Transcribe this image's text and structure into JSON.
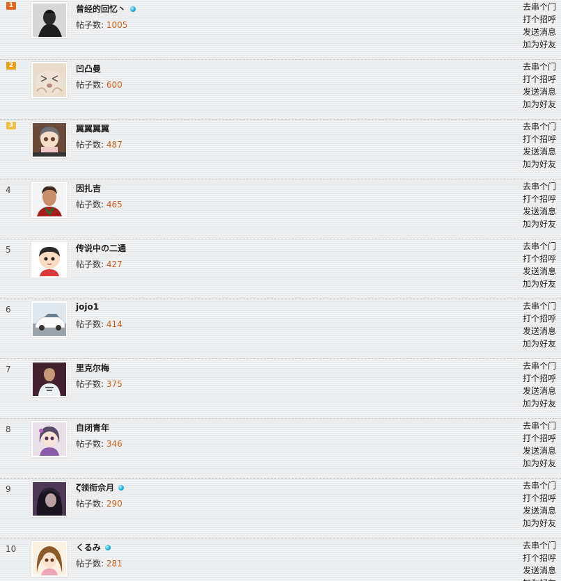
{
  "posts_label": "帖子数:",
  "actions": [
    "去串个门",
    "打个招呼",
    "发送消息",
    "加为好友"
  ],
  "colors": {
    "rank1": "#e06a20",
    "rank2": "#e8a318",
    "rank3": "#f0bf47",
    "post_count": "#c8601e"
  },
  "users": [
    {
      "rank": "1",
      "name": "曾经的回忆丶",
      "posts": "1005",
      "vip": true,
      "badge": "rank1",
      "avatar": "dark-portrait-avatar"
    },
    {
      "rank": "2",
      "name": "凹凸曼",
      "posts": "600",
      "vip": false,
      "badge": "rank2",
      "avatar": "cartoon-face-avatar"
    },
    {
      "rank": "3",
      "name": "翼翼翼翼",
      "posts": "487",
      "vip": false,
      "badge": "rank3",
      "avatar": "anime-girl-avatar"
    },
    {
      "rank": "4",
      "name": "因扎吉",
      "posts": "465",
      "vip": false,
      "badge": null,
      "avatar": "man-portrait-avatar"
    },
    {
      "rank": "5",
      "name": "传说中の二通",
      "posts": "427",
      "vip": false,
      "badge": null,
      "avatar": "cartoon-boy-avatar"
    },
    {
      "rank": "6",
      "name": "jojo1",
      "posts": "414",
      "vip": false,
      "badge": null,
      "avatar": "white-car-avatar"
    },
    {
      "rank": "7",
      "name": "里克尔梅",
      "posts": "375",
      "vip": false,
      "badge": null,
      "avatar": "player-photo-avatar"
    },
    {
      "rank": "8",
      "name": "自闭青年",
      "posts": "346",
      "vip": false,
      "badge": null,
      "avatar": "anime-character-avatar"
    },
    {
      "rank": "9",
      "name": "ζั领衔佘月",
      "posts": "290",
      "vip": true,
      "badge": null,
      "avatar": "dark-hair-avatar"
    },
    {
      "rank": "10",
      "name": "くるみ",
      "posts": "281",
      "vip": true,
      "badge": null,
      "avatar": "anime-kurumi-avatar"
    }
  ]
}
